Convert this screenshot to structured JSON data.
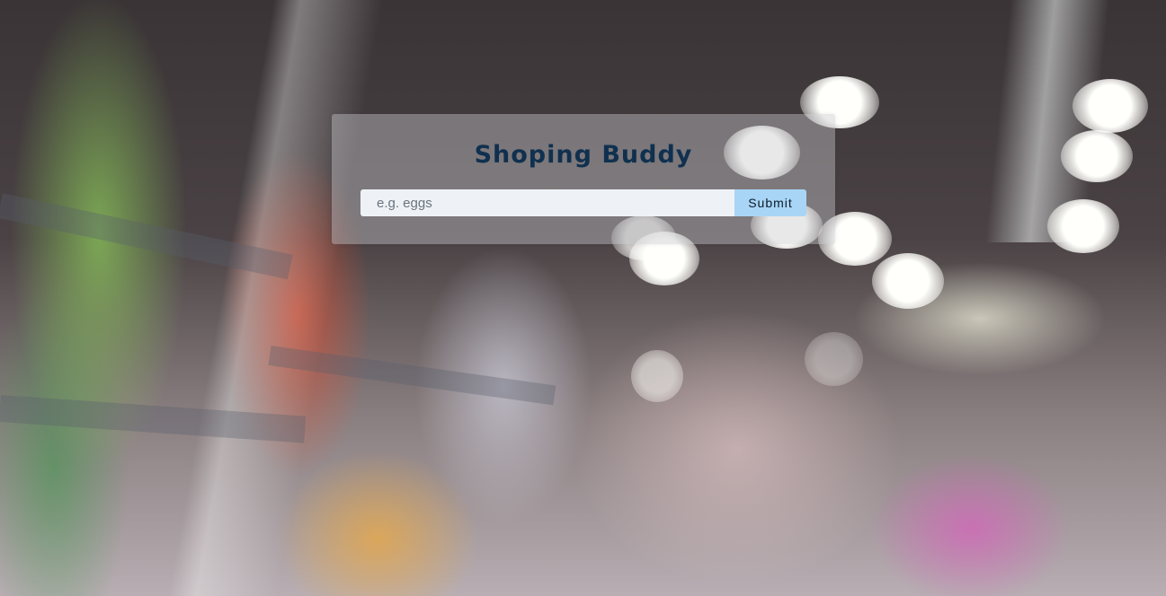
{
  "app": {
    "title": "Shoping Buddy"
  },
  "search": {
    "placeholder": "e.g. eggs",
    "value": "",
    "submit_label": "Submit"
  },
  "background": {
    "description_icon": "blurred-supermarket-aisle-photo"
  },
  "colors": {
    "title": "#10304f",
    "submit_bg": "#a8d5f6",
    "input_bg": "#eef2f6"
  }
}
